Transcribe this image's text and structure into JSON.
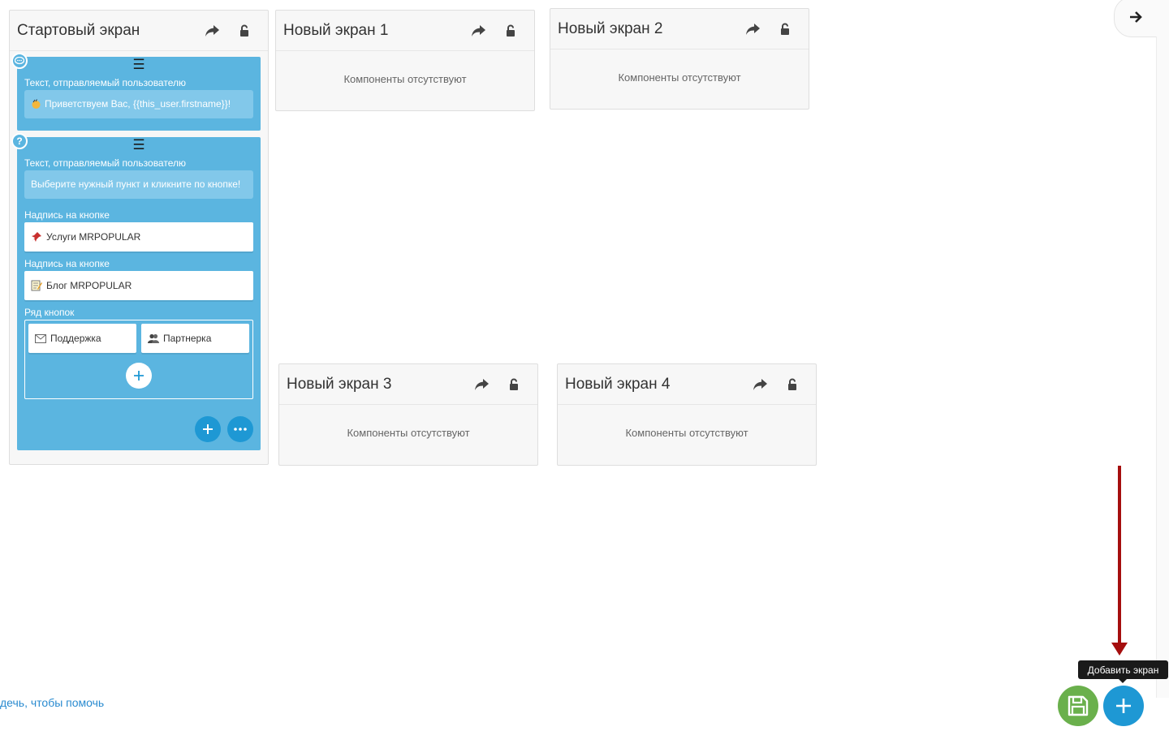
{
  "screens": {
    "start": {
      "title": "Стартовый экран"
    },
    "s1": {
      "title": "Новый экран 1",
      "empty": "Компоненты отсутствуют"
    },
    "s2": {
      "title": "Новый экран 2",
      "empty": "Компоненты отсутствуют"
    },
    "s3": {
      "title": "Новый экран 3",
      "empty": "Компоненты отсутствуют"
    },
    "s4": {
      "title": "Новый экран 4",
      "empty": "Компоненты отсутствуют"
    }
  },
  "components": {
    "message": {
      "label": "Текст, отправляемый пользователю",
      "text": "Приветствуем Вас, {{this_user.firstname}}!"
    },
    "question": {
      "label": "Текст, отправляемый пользователю",
      "text": "Выберите нужный пункт и кликните по кнопке!",
      "button1_label": "Надпись на кнопке",
      "button1_text": "Услуги MRPOPULAR",
      "button2_label": "Надпись на кнопке",
      "button2_text": "Блог MRPOPULAR",
      "row_label": "Ряд кнопок",
      "row_btn1": "Поддержка",
      "row_btn2": "Партнерка"
    }
  },
  "icons": {
    "handle": "☰",
    "share": "share-arrow-icon",
    "lock": "unlock-icon",
    "message_badge": "chat-bubble-icon",
    "question_badge": "question-icon"
  },
  "help_text": "дечь, чтобы помочь",
  "tooltip": "Добавить экран",
  "colors": {
    "component_bg": "#5bb5e0",
    "accent_blue": "#1e98d4",
    "save_green": "#6ab04c",
    "arrow_red": "#a50e0e"
  }
}
